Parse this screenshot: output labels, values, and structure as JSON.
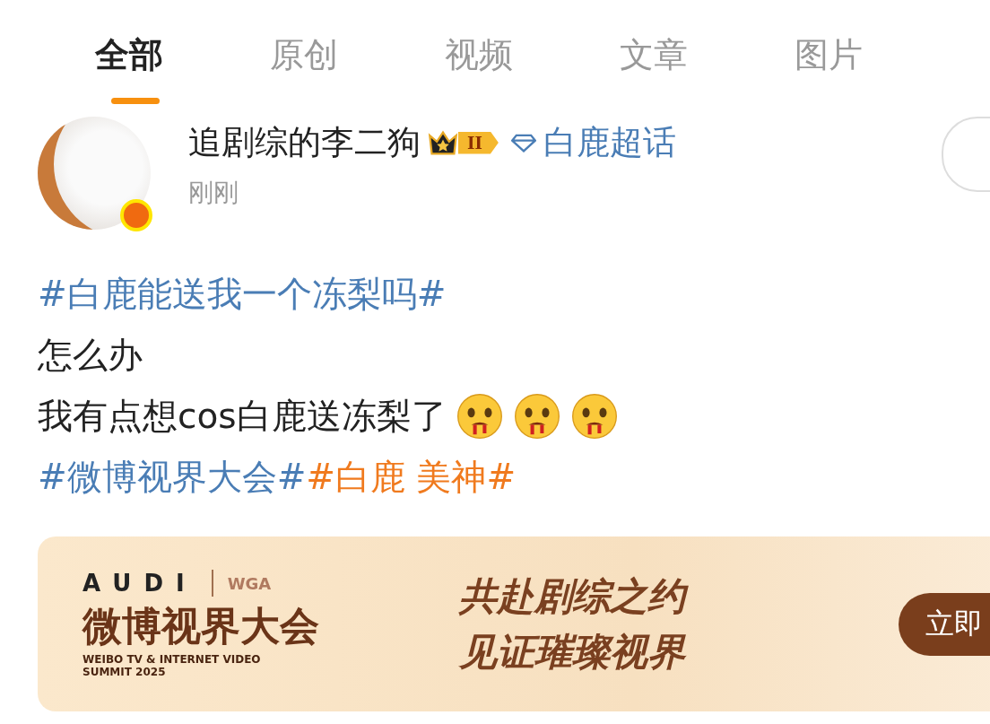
{
  "tabs": [
    {
      "label": "全部",
      "selected": true
    },
    {
      "label": "原创",
      "selected": false
    },
    {
      "label": "视频",
      "selected": false
    },
    {
      "label": "文章",
      "selected": false
    },
    {
      "label": "图片",
      "selected": false
    }
  ],
  "post": {
    "author": "追剧综的李二狗",
    "verified": true,
    "badge": "II",
    "topic": "白鹿超话",
    "time": "刚刚",
    "lines": [
      {
        "segments": [
          {
            "kind": "text",
            "text": "#白鹿能送我一个冻梨吗#",
            "color": "#4a7db5"
          }
        ]
      },
      {
        "segments": [
          {
            "kind": "text",
            "text": "怎么办",
            "color": "#222222"
          }
        ]
      },
      {
        "segments": [
          {
            "kind": "text",
            "text": "我有点想cos白鹿送冻梨了",
            "color": "#222222"
          },
          {
            "kind": "emoji"
          },
          {
            "kind": "emoji"
          },
          {
            "kind": "emoji"
          }
        ]
      },
      {
        "segments": [
          {
            "kind": "text",
            "text": "#微博视界大会#",
            "color": "#4a7db5"
          },
          {
            "kind": "text",
            "text": "#白鹿 美神#",
            "color": "#f07a1e"
          }
        ]
      }
    ]
  },
  "banner": {
    "brand": "AUDI",
    "logo": "WGA",
    "title": "微博视界大会",
    "subtitle_lines": [
      "WEIBO TV & INTERNET VIDEO",
      "SUMMIT 2025"
    ],
    "slogan_lines": [
      "共赴剧综之约",
      "见证璀璨视界"
    ],
    "button": "立即"
  }
}
